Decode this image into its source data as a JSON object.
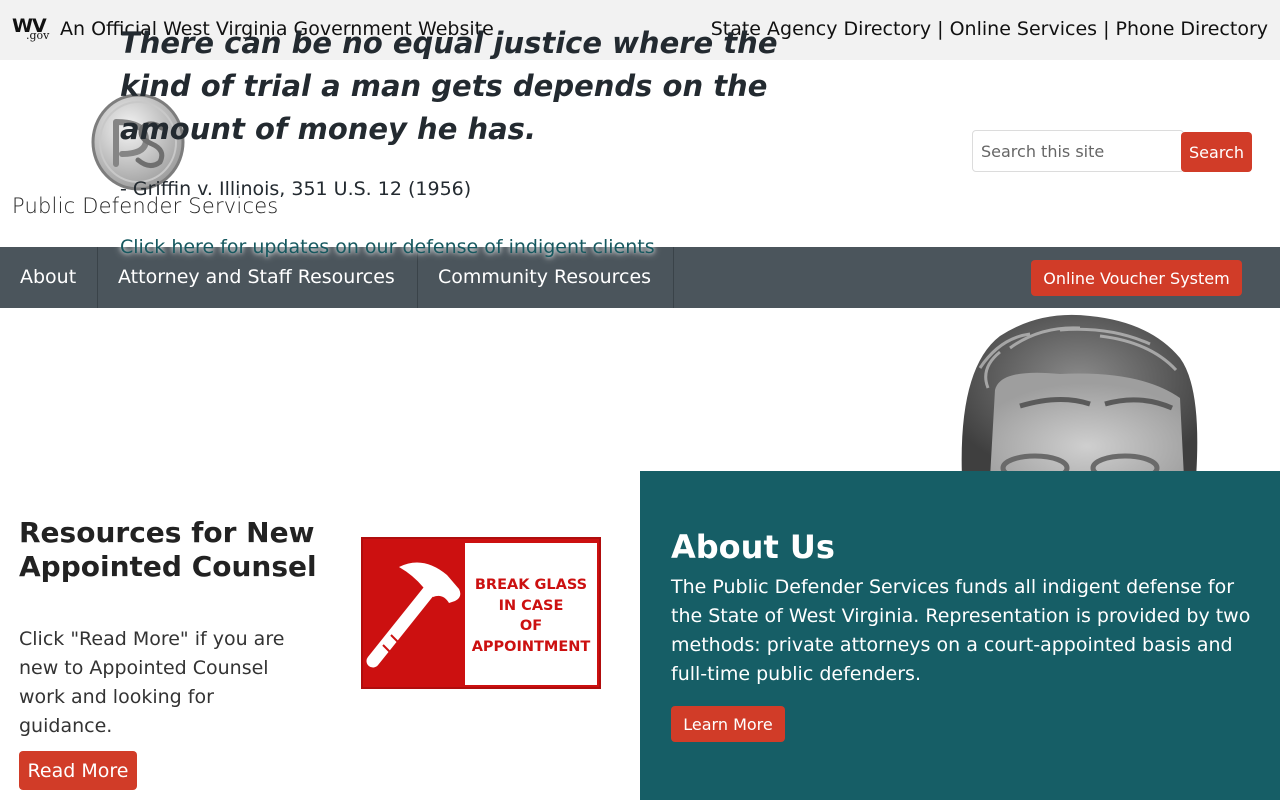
{
  "gov_bar": {
    "official_text": "An Official West Virginia Government Website",
    "links": [
      "State Agency Directory",
      "Online Services",
      "Phone Directory"
    ],
    "separator": " | "
  },
  "logo": {
    "name": "Public Defender Services"
  },
  "quote": {
    "text": "There can be no equal justice where the kind of trial a man gets depends on the amount of money he has.",
    "citation": "- Griffin v. Illinois, 351 U.S. 12 (1956)",
    "link_text": "Click here for updates on our defense of indigent clients"
  },
  "search": {
    "placeholder": "Search this site",
    "button_label": "Search"
  },
  "nav": {
    "items": [
      {
        "label": "About"
      },
      {
        "label": "Attorney and Staff Resources"
      },
      {
        "label": "Community Resources"
      }
    ],
    "voucher_button": "Online Voucher System"
  },
  "resources": {
    "title": "Resources for New Appointed Counsel",
    "text": "Click \"Read More\" if you are new to Appointed Counsel work and looking for guidance.",
    "button_label": "Read More",
    "sign_text": [
      "BREAK GLASS",
      "IN CASE",
      "OF",
      "APPOINTMENT"
    ]
  },
  "about": {
    "title": "About Us",
    "text": "The Public Defender Services funds all indigent defense for the State of West Virginia. Representation is provided by two methods: private attorneys on a court-appointed basis and full-time public defenders.",
    "button_label": "Learn More"
  },
  "colors": {
    "accent": "#d13c28",
    "nav_bg": "#4b555c",
    "about_bg": "#165e66",
    "gov_bar_bg": "#f2f2f2"
  }
}
